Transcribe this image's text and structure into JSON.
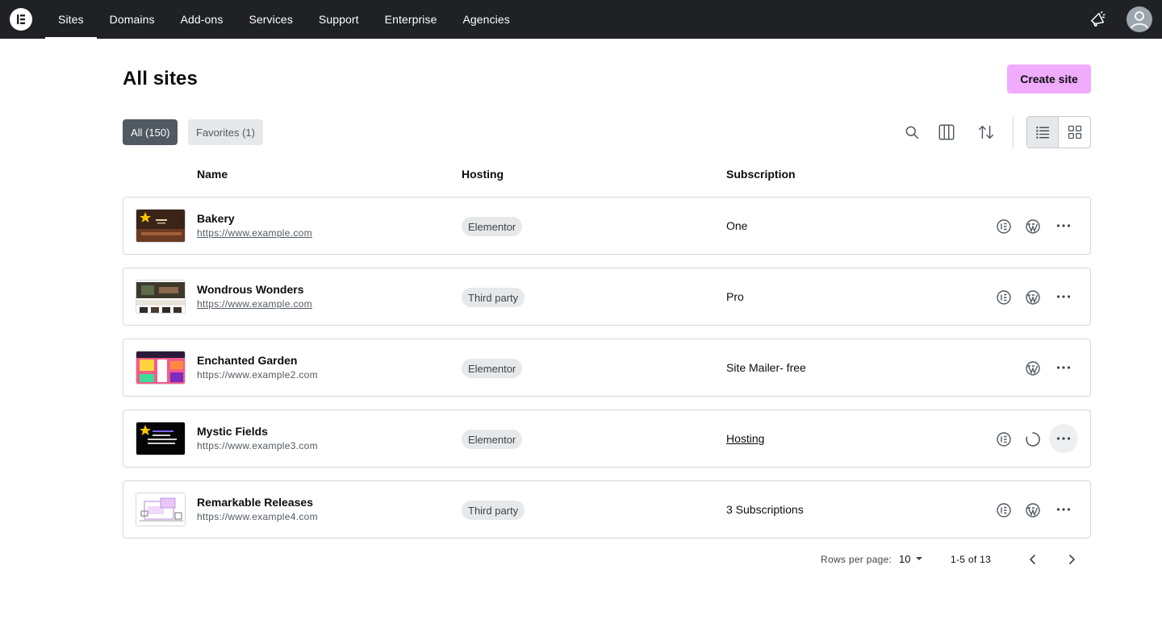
{
  "nav": {
    "logo_icon": "elementor-logo-icon",
    "items": [
      {
        "label": "Sites",
        "active": true
      },
      {
        "label": "Domains"
      },
      {
        "label": "Add-ons"
      },
      {
        "label": "Services"
      },
      {
        "label": "Support"
      },
      {
        "label": "Enterprise"
      },
      {
        "label": "Agencies"
      }
    ],
    "announcement_icon": "megaphone-icon",
    "avatar_icon": "user-avatar-icon"
  },
  "header": {
    "title": "All sites",
    "create_button": "Create site"
  },
  "filters": {
    "all": "All (150)",
    "favorites": "Favorites (1)"
  },
  "toolbar": {
    "icons": [
      "search-icon",
      "columns-icon",
      "sort-icon",
      "list-view-icon",
      "grid-view-icon"
    ],
    "active_view": "list"
  },
  "table": {
    "columns": [
      "Name",
      "Hosting",
      "Subscription"
    ],
    "rows": [
      {
        "name": "Bakery",
        "url": "https://www.example.com",
        "hosting": "Elementor",
        "subscription": "One",
        "favorite": true
      },
      {
        "name": "Wondrous Wonders",
        "url": "https://www.example.com",
        "hosting": "Third party",
        "subscription": "Pro",
        "favorite": false
      },
      {
        "name": "Enchanted Garden",
        "url": "https://www.example2.com",
        "hosting": "Elementor",
        "subscription": "Site Mailer- free",
        "favorite": false
      },
      {
        "name": "Mystic Fields",
        "url": "https://www.example3.com",
        "hosting": "Elementor",
        "subscription": "Hosting",
        "favorite": true
      },
      {
        "name": "Remarkable Releases",
        "url": "https://www.example4.com",
        "hosting": "Third party",
        "subscription": "3 Subscriptions",
        "favorite": false
      }
    ]
  },
  "pagination": {
    "rows_per_page_label": "Rows per page:",
    "rows_per_page": "10",
    "range": "1-5 of 13"
  },
  "colors": {
    "topnav_bg": "#1f2124",
    "create_button_bg": "#f0abfc",
    "filter_active_bg": "#515962",
    "chip_bg": "#e6e8ea"
  }
}
